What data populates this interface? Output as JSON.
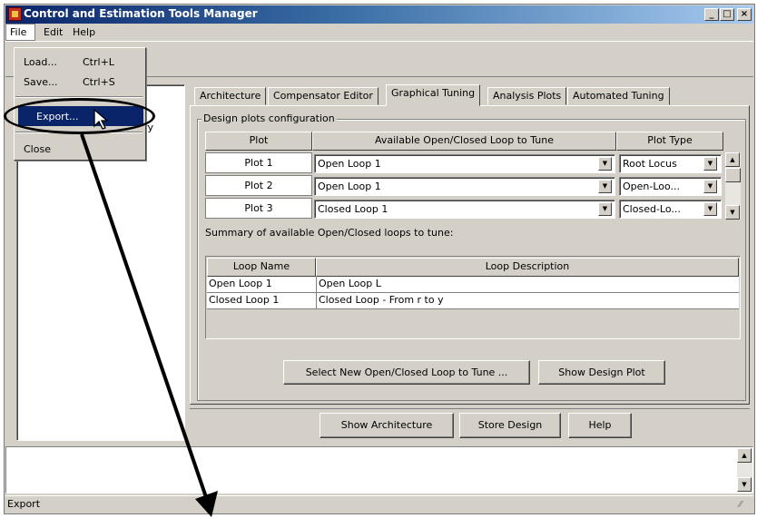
{
  "window": {
    "title": "Control and Estimation Tools Manager"
  },
  "window_controls": {
    "minimize": "_",
    "maximize": "□",
    "close": "×"
  },
  "menubar": [
    {
      "label": "File"
    },
    {
      "label": "Edit"
    },
    {
      "label": "Help"
    }
  ],
  "file_menu": {
    "items": [
      {
        "label": "Load...",
        "shortcut": "Ctrl+L"
      },
      {
        "label": "Save...",
        "shortcut": "Ctrl+S"
      },
      {
        "label": "Export...",
        "shortcut": ""
      },
      {
        "label": "Close",
        "shortcut": ""
      }
    ],
    "highlighted": "Export..."
  },
  "tree": {
    "partial_label": "ry"
  },
  "tabs": [
    {
      "label": "Architecture"
    },
    {
      "label": "Compensator Editor"
    },
    {
      "label": "Graphical Tuning"
    },
    {
      "label": "Analysis Plots"
    },
    {
      "label": "Automated Tuning"
    }
  ],
  "active_tab": "Graphical Tuning",
  "design_plots": {
    "group_label": "Design plots configuration",
    "headers": [
      "Plot",
      "Available Open/Closed Loop to Tune",
      "Plot Type"
    ],
    "rows": [
      {
        "plot": "Plot 1",
        "loop": "Open Loop 1",
        "type": "Root Locus"
      },
      {
        "plot": "Plot 2",
        "loop": "Open Loop 1",
        "type": "Open-Loo..."
      },
      {
        "plot": "Plot 3",
        "loop": "Closed Loop 1",
        "type": "Closed-Lo..."
      }
    ]
  },
  "summary": {
    "label": "Summary of available Open/Closed loops to tune:",
    "headers": [
      "Loop Name",
      "Loop Description"
    ],
    "rows": [
      {
        "name": "Open Loop 1",
        "description": "Open Loop L"
      },
      {
        "name": "Closed Loop 1",
        "description": "Closed Loop - From r to y"
      }
    ]
  },
  "buttons": {
    "select_new": "Select New Open/Closed Loop to Tune ...",
    "show_design_plot": "Show Design Plot",
    "show_architecture": "Show Architecture",
    "store_design": "Store Design",
    "help": "Help"
  },
  "status": {
    "text": "Export"
  },
  "colors": {
    "title_bar": "#0a246a",
    "highlight": "#0a246a",
    "face": "#d4d0c8"
  }
}
